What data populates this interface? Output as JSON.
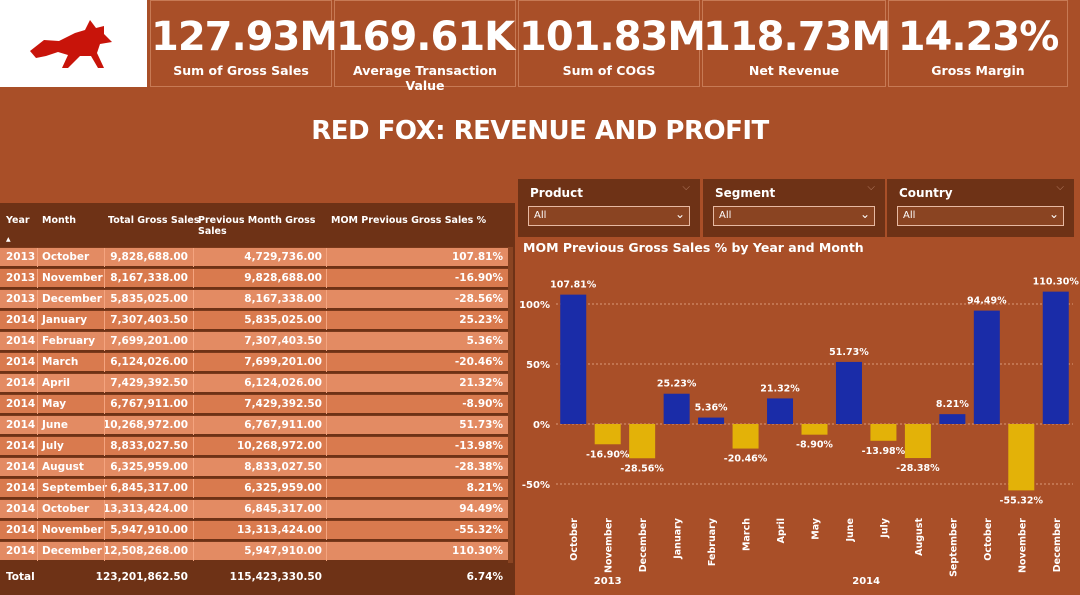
{
  "colors": {
    "background": "#a94f28",
    "panel_dark": "#6e3216",
    "row_light": "#e38b63",
    "row_dark": "#d97a4e",
    "bar_positive": "#1a2ca8",
    "bar_negative": "#e3b208",
    "logo_red": "#c8140a"
  },
  "kpis": [
    {
      "value": "127.93M",
      "label": "Sum of Gross Sales"
    },
    {
      "value": "169.61K",
      "label": "Average Transaction Value"
    },
    {
      "value": "101.83M",
      "label": "Sum of COGS"
    },
    {
      "value": "118.73M",
      "label": "Net Revenue"
    },
    {
      "value": "14.23%",
      "label": "Gross Margin"
    }
  ],
  "title": "RED FOX: REVENUE AND PROFIT",
  "table": {
    "headers": [
      "Year",
      "Month",
      "Total Gross Sales",
      "Previous Month Gross Sales",
      "MOM Previous Gross Sales %"
    ],
    "rows": [
      [
        "2013",
        "October",
        "9,828,688.00",
        "4,729,736.00",
        "107.81%"
      ],
      [
        "2013",
        "November",
        "8,167,338.00",
        "9,828,688.00",
        "-16.90%"
      ],
      [
        "2013",
        "December",
        "5,835,025.00",
        "8,167,338.00",
        "-28.56%"
      ],
      [
        "2014",
        "January",
        "7,307,403.50",
        "5,835,025.00",
        "25.23%"
      ],
      [
        "2014",
        "February",
        "7,699,201.00",
        "7,307,403.50",
        "5.36%"
      ],
      [
        "2014",
        "March",
        "6,124,026.00",
        "7,699,201.00",
        "-20.46%"
      ],
      [
        "2014",
        "April",
        "7,429,392.50",
        "6,124,026.00",
        "21.32%"
      ],
      [
        "2014",
        "May",
        "6,767,911.00",
        "7,429,392.50",
        "-8.90%"
      ],
      [
        "2014",
        "June",
        "10,268,972.00",
        "6,767,911.00",
        "51.73%"
      ],
      [
        "2014",
        "July",
        "8,833,027.50",
        "10,268,972.00",
        "-13.98%"
      ],
      [
        "2014",
        "August",
        "6,325,959.00",
        "8,833,027.50",
        "-28.38%"
      ],
      [
        "2014",
        "September",
        "6,845,317.00",
        "6,325,959.00",
        "8.21%"
      ],
      [
        "2014",
        "October",
        "13,313,424.00",
        "6,845,317.00",
        "94.49%"
      ],
      [
        "2014",
        "November",
        "5,947,910.00",
        "13,313,424.00",
        "-55.32%"
      ],
      [
        "2014",
        "December",
        "12,508,268.00",
        "5,947,910.00",
        "110.30%"
      ]
    ],
    "total": {
      "label": "Total",
      "gross": "123,201,862.50",
      "prev": "115,423,330.50",
      "mom": "6.74%"
    }
  },
  "slicers": [
    {
      "title": "Product",
      "value": "All"
    },
    {
      "title": "Segment",
      "value": "All"
    },
    {
      "title": "Country",
      "value": "All"
    }
  ],
  "chart_data": {
    "type": "bar",
    "title": "MOM Previous Gross Sales % by Year and Month",
    "categories": [
      "October",
      "November",
      "December",
      "January",
      "February",
      "March",
      "April",
      "May",
      "June",
      "July",
      "August",
      "September",
      "October",
      "November",
      "December"
    ],
    "years": [
      {
        "label": "2013",
        "months": 3
      },
      {
        "label": "2014",
        "months": 12
      }
    ],
    "values": [
      107.81,
      -16.9,
      -28.56,
      25.23,
      5.36,
      -20.46,
      21.32,
      -8.9,
      51.73,
      -13.98,
      -28.38,
      8.21,
      94.49,
      -55.32,
      110.3
    ],
    "data_labels": [
      "107.81%",
      "-16.90%",
      "-28.56%",
      "25.23%",
      "5.36%",
      "-20.46%",
      "21.32%",
      "-8.90%",
      "51.73%",
      "-13.98%",
      "-28.38%",
      "8.21%",
      "94.49%",
      "-55.32%",
      "110.30%"
    ],
    "yticks": [
      100,
      50,
      0,
      -50
    ],
    "ytick_labels": [
      "100%",
      "50%",
      "0%",
      "-50%"
    ],
    "ylim": [
      -60,
      115
    ],
    "grid": true
  }
}
